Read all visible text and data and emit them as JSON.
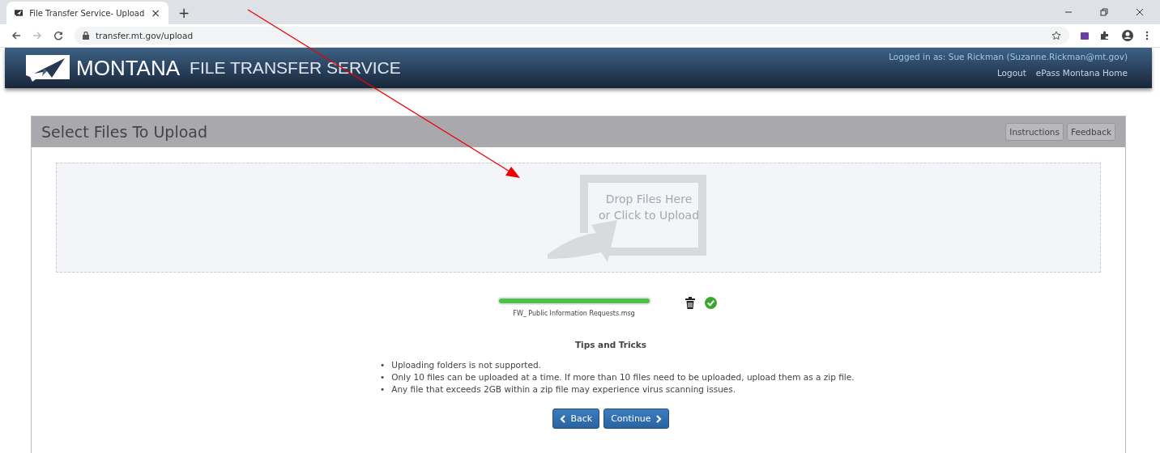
{
  "browser": {
    "tab_title": "File Transfer Service- Upload",
    "tab_close": "×",
    "new_tab": "+",
    "url": "transfer.mt.gov/upload"
  },
  "header": {
    "brand": "MONTANA",
    "subtitle": "FILE TRANSFER SERVICE",
    "logged_in": "Logged in as: Sue Rickman (Suzanne.Rickman@mt.gov)",
    "links": [
      "Logout",
      "ePass Montana Home"
    ]
  },
  "panel": {
    "title": "Select Files To Upload",
    "buttons": [
      "Instructions",
      "Feedback"
    ],
    "dropzone": {
      "line1": "Drop Files Here",
      "line2": "or Click to Upload"
    },
    "files": [
      {
        "name": "FW_ Public Information Requests.msg",
        "level": 1,
        "done": true
      }
    ],
    "tips": {
      "title": "Tips and Tricks",
      "marker": "•",
      "items": [
        "Uploading folders is not supported.",
        "Only 10 files can be uploaded at a time. If more than 10 files need to be uploaded, upload them as a zip file.",
        "Any file that exceeds 2GB within a zip file may experience virus scanning issues."
      ]
    },
    "back": "Back",
    "continue": "Continue"
  }
}
